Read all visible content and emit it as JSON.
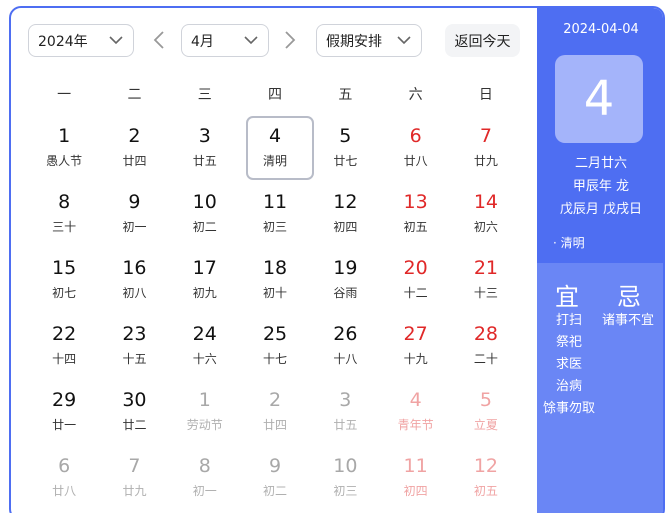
{
  "toolbar": {
    "year": "2024年",
    "month": "4月",
    "holiday": "假期安排",
    "today_button": "返回今天"
  },
  "weekdays": [
    "一",
    "二",
    "三",
    "四",
    "五",
    "六",
    "日"
  ],
  "days": [
    {
      "n": "1",
      "l": "愚人节",
      "w": false,
      "o": false,
      "s": false
    },
    {
      "n": "2",
      "l": "廿四",
      "w": false,
      "o": false,
      "s": false
    },
    {
      "n": "3",
      "l": "廿五",
      "w": false,
      "o": false,
      "s": false
    },
    {
      "n": "4",
      "l": "清明",
      "w": false,
      "o": false,
      "s": true
    },
    {
      "n": "5",
      "l": "廿七",
      "w": false,
      "o": false,
      "s": false
    },
    {
      "n": "6",
      "l": "廿八",
      "w": true,
      "o": false,
      "s": false
    },
    {
      "n": "7",
      "l": "廿九",
      "w": true,
      "o": false,
      "s": false
    },
    {
      "n": "8",
      "l": "三十",
      "w": false,
      "o": false,
      "s": false
    },
    {
      "n": "9",
      "l": "初一",
      "w": false,
      "o": false,
      "s": false
    },
    {
      "n": "10",
      "l": "初二",
      "w": false,
      "o": false,
      "s": false
    },
    {
      "n": "11",
      "l": "初三",
      "w": false,
      "o": false,
      "s": false
    },
    {
      "n": "12",
      "l": "初四",
      "w": false,
      "o": false,
      "s": false
    },
    {
      "n": "13",
      "l": "初五",
      "w": true,
      "o": false,
      "s": false
    },
    {
      "n": "14",
      "l": "初六",
      "w": true,
      "o": false,
      "s": false
    },
    {
      "n": "15",
      "l": "初七",
      "w": false,
      "o": false,
      "s": false
    },
    {
      "n": "16",
      "l": "初八",
      "w": false,
      "o": false,
      "s": false
    },
    {
      "n": "17",
      "l": "初九",
      "w": false,
      "o": false,
      "s": false
    },
    {
      "n": "18",
      "l": "初十",
      "w": false,
      "o": false,
      "s": false
    },
    {
      "n": "19",
      "l": "谷雨",
      "w": false,
      "o": false,
      "s": false
    },
    {
      "n": "20",
      "l": "十二",
      "w": true,
      "o": false,
      "s": false
    },
    {
      "n": "21",
      "l": "十三",
      "w": true,
      "o": false,
      "s": false
    },
    {
      "n": "22",
      "l": "十四",
      "w": false,
      "o": false,
      "s": false
    },
    {
      "n": "23",
      "l": "十五",
      "w": false,
      "o": false,
      "s": false
    },
    {
      "n": "24",
      "l": "十六",
      "w": false,
      "o": false,
      "s": false
    },
    {
      "n": "25",
      "l": "十七",
      "w": false,
      "o": false,
      "s": false
    },
    {
      "n": "26",
      "l": "十八",
      "w": false,
      "o": false,
      "s": false
    },
    {
      "n": "27",
      "l": "十九",
      "w": true,
      "o": false,
      "s": false
    },
    {
      "n": "28",
      "l": "二十",
      "w": true,
      "o": false,
      "s": false
    },
    {
      "n": "29",
      "l": "廿一",
      "w": false,
      "o": false,
      "s": false
    },
    {
      "n": "30",
      "l": "廿二",
      "w": false,
      "o": false,
      "s": false
    },
    {
      "n": "1",
      "l": "劳动节",
      "w": false,
      "o": true,
      "s": false
    },
    {
      "n": "2",
      "l": "廿四",
      "w": false,
      "o": true,
      "s": false
    },
    {
      "n": "3",
      "l": "廿五",
      "w": false,
      "o": true,
      "s": false
    },
    {
      "n": "4",
      "l": "青年节",
      "w": true,
      "o": true,
      "s": false
    },
    {
      "n": "5",
      "l": "立夏",
      "w": true,
      "o": true,
      "s": false
    },
    {
      "n": "6",
      "l": "廿八",
      "w": false,
      "o": true,
      "s": false
    },
    {
      "n": "7",
      "l": "廿九",
      "w": false,
      "o": true,
      "s": false
    },
    {
      "n": "8",
      "l": "初一",
      "w": false,
      "o": true,
      "s": false
    },
    {
      "n": "9",
      "l": "初二",
      "w": false,
      "o": true,
      "s": false
    },
    {
      "n": "10",
      "l": "初三",
      "w": false,
      "o": true,
      "s": false
    },
    {
      "n": "11",
      "l": "初四",
      "w": true,
      "o": true,
      "s": false
    },
    {
      "n": "12",
      "l": "初五",
      "w": true,
      "o": true,
      "s": false
    }
  ],
  "side": {
    "date": "2024-04-04",
    "big_day": "4",
    "lunar": "二月廿六",
    "year_gz": "甲辰年 龙",
    "month_day_gz": "戊辰月 戊戌日",
    "festival": "· 清明",
    "yi_label": "宜",
    "ji_label": "忌",
    "yi": [
      "打扫",
      "祭祀",
      "求医",
      "治病",
      "馀事勿取"
    ],
    "ji": [
      "诸事不宜"
    ]
  },
  "colors": {
    "accent": "#4e6ef2",
    "accent_light": "#6a86f5",
    "weekend": "#e02828"
  },
  "icons": {
    "dropdown": "chevron-down-icon",
    "prev": "chevron-left-icon",
    "next": "chevron-right-icon"
  }
}
